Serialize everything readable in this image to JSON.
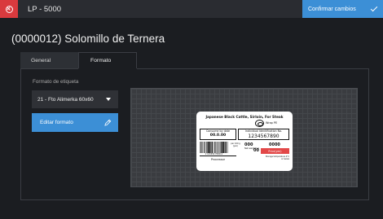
{
  "window": {
    "title": "LP - 5000"
  },
  "toolbar": {
    "confirm_label": "Confirmar cambios"
  },
  "product": {
    "title": "(0000012) Solomillo de Ternera"
  },
  "tabs": [
    {
      "label": "General",
      "active": false
    },
    {
      "label": "Formato",
      "active": true
    }
  ],
  "form": {
    "label_format_caption": "Formato de etiqueta",
    "label_format_value": "21 - Fto Alimerka 60x60",
    "edit_format_label": "Editar formato"
  },
  "preview_label": {
    "title": "Japanese Black Cattle, Sirloin, For Steak",
    "wrap_text": "Wrap PE",
    "consumed_by_caption": "Consume by date",
    "consumed_by_value": "00.0.00",
    "ident_caption": "Individual Identification No.",
    "ident_value": "1234567890",
    "barcode_number": "2 123456 789012",
    "small_caption": "per 100 g (yen)",
    "big_value_1": "000",
    "big_value_2": "0000",
    "small_caption_2": "Net weight(g)",
    "big_value_3": "00",
    "price_caption": "Price(yen)",
    "processor_label": "Processor",
    "fine_print": "Storage temperature 4°C or below"
  },
  "colors": {
    "accent": "#3c8fd6",
    "close": "#d93a3e",
    "background": "#1b1d21",
    "price_bar": "#e24848"
  },
  "icons": {
    "close": "close-icon",
    "confirm": "check-icon",
    "select_caret": "caret-down-icon",
    "edit": "pencil-icon",
    "wrap": "wrap-pe-icon"
  }
}
